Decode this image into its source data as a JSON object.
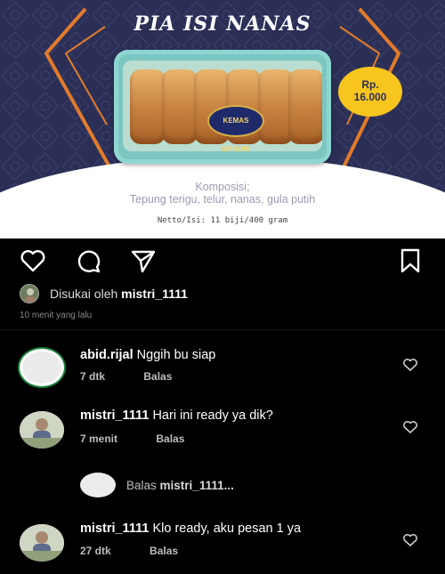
{
  "post": {
    "title": "PIA ISI NANAS",
    "brand_label": "KEMAS MANDIS",
    "price_line1": "Rp.",
    "price_line2": "16.000",
    "komposisi_title": "Komposisi;",
    "komposisi_text": "Tepung terigu, telur, nanas, gula putih",
    "netto": "Netto/Isi: 11 biji/400 gram"
  },
  "actions": {
    "icons": [
      "heart-icon",
      "comment-icon",
      "share-icon",
      "bookmark-icon"
    ]
  },
  "likes": {
    "prefix": "Disukai oleh",
    "user": "mistri_1111"
  },
  "time_ago": "10 menit yang lalu",
  "comments": [
    {
      "user": "abid.rijal",
      "text": "Nggih bu siap",
      "time": "7 dtk",
      "reply_label": "Balas"
    },
    {
      "user": "mistri_1111",
      "text": "Hari ini ready ya dik?",
      "time": "7 menit",
      "reply_label": "Balas"
    },
    {
      "user": "mistri_1111",
      "text": "Klo ready, aku pesan 1 ya",
      "time": "27 dtk",
      "reply_label": "Balas"
    }
  ],
  "reply_box": {
    "prefix": "Balas",
    "target": "mistri_1111..."
  },
  "colors": {
    "background": "#000000",
    "post_bg": "#2b2f56",
    "accent_orange": "#e27b2b",
    "price_badge": "#f7c51e"
  }
}
